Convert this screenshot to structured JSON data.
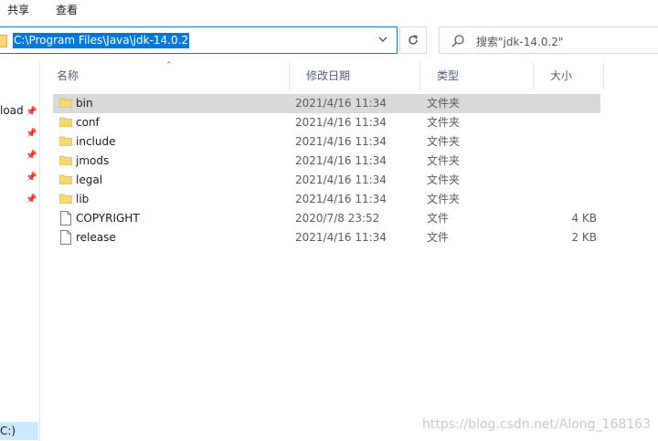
{
  "ribbon": {
    "tabs": [
      "共享",
      "查看"
    ]
  },
  "address": {
    "path": "C:\\Program Files\\Java\\jdk-14.0.2"
  },
  "search": {
    "placeholder": "搜索\"jdk-14.0.2\""
  },
  "nav": {
    "quick_access_label": "load",
    "drive_label": "C:)"
  },
  "columns": {
    "name": "名称",
    "date": "修改日期",
    "type": "类型",
    "size": "大小"
  },
  "files": [
    {
      "name": "bin",
      "date": "2021/4/16 11:34",
      "type": "文件夹",
      "size": "",
      "kind": "folder"
    },
    {
      "name": "conf",
      "date": "2021/4/16 11:34",
      "type": "文件夹",
      "size": "",
      "kind": "folder"
    },
    {
      "name": "include",
      "date": "2021/4/16 11:34",
      "type": "文件夹",
      "size": "",
      "kind": "folder"
    },
    {
      "name": "jmods",
      "date": "2021/4/16 11:34",
      "type": "文件夹",
      "size": "",
      "kind": "folder"
    },
    {
      "name": "legal",
      "date": "2021/4/16 11:34",
      "type": "文件夹",
      "size": "",
      "kind": "folder"
    },
    {
      "name": "lib",
      "date": "2021/4/16 11:34",
      "type": "文件夹",
      "size": "",
      "kind": "folder"
    },
    {
      "name": "COPYRIGHT",
      "date": "2020/7/8 23:52",
      "type": "文件",
      "size": "4 KB",
      "kind": "file"
    },
    {
      "name": "release",
      "date": "2021/4/16 11:34",
      "type": "文件",
      "size": "2 KB",
      "kind": "file"
    }
  ],
  "selected_index": 0,
  "watermark": "https://blog.csdn.net/Along_168163",
  "colors": {
    "accent": "#0078d7",
    "folder": "#f8d775",
    "selected_row": "#d9d9d9"
  }
}
